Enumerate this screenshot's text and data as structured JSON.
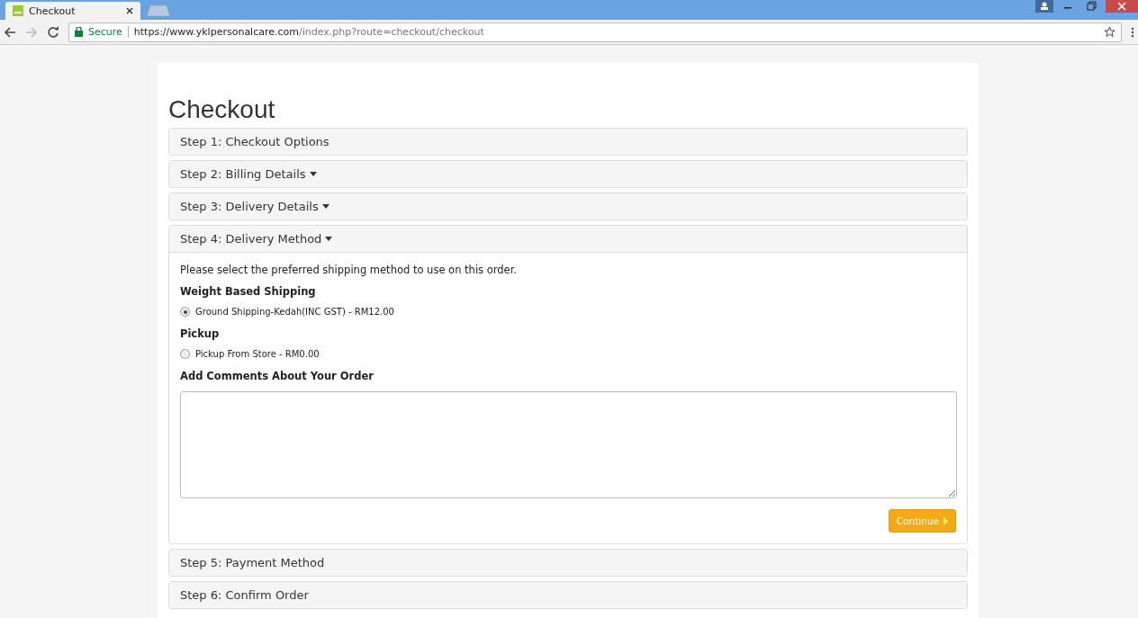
{
  "browser": {
    "tab_title": "Checkout",
    "secure_label": "Secure",
    "url_host": "https://www.yklpersonalcare.com",
    "url_path": "/index.php?route=checkout/checkout"
  },
  "heading": "Checkout",
  "steps": [
    {
      "title": "Step 1: Checkout Options",
      "caret": false,
      "expanded": false
    },
    {
      "title": "Step 2: Billing Details",
      "caret": true,
      "expanded": false
    },
    {
      "title": "Step 3: Delivery Details",
      "caret": true,
      "expanded": false
    },
    {
      "title": "Step 4: Delivery Method",
      "caret": true,
      "expanded": true,
      "intro": "Please select the preferred shipping method to use on this order.",
      "groups": [
        {
          "title": "Weight Based Shipping",
          "options": [
            {
              "label": "Ground Shipping-Kedah(INC GST) - RM12.00",
              "selected": true
            }
          ]
        },
        {
          "title": "Pickup",
          "options": [
            {
              "label": "Pickup From Store - RM0.00",
              "selected": false
            }
          ]
        }
      ],
      "comments_label": "Add Comments About Your Order",
      "button": "Continue"
    },
    {
      "title": "Step 5: Payment Method",
      "caret": false,
      "expanded": false
    },
    {
      "title": "Step 6: Confirm Order",
      "caret": false,
      "expanded": false
    }
  ]
}
